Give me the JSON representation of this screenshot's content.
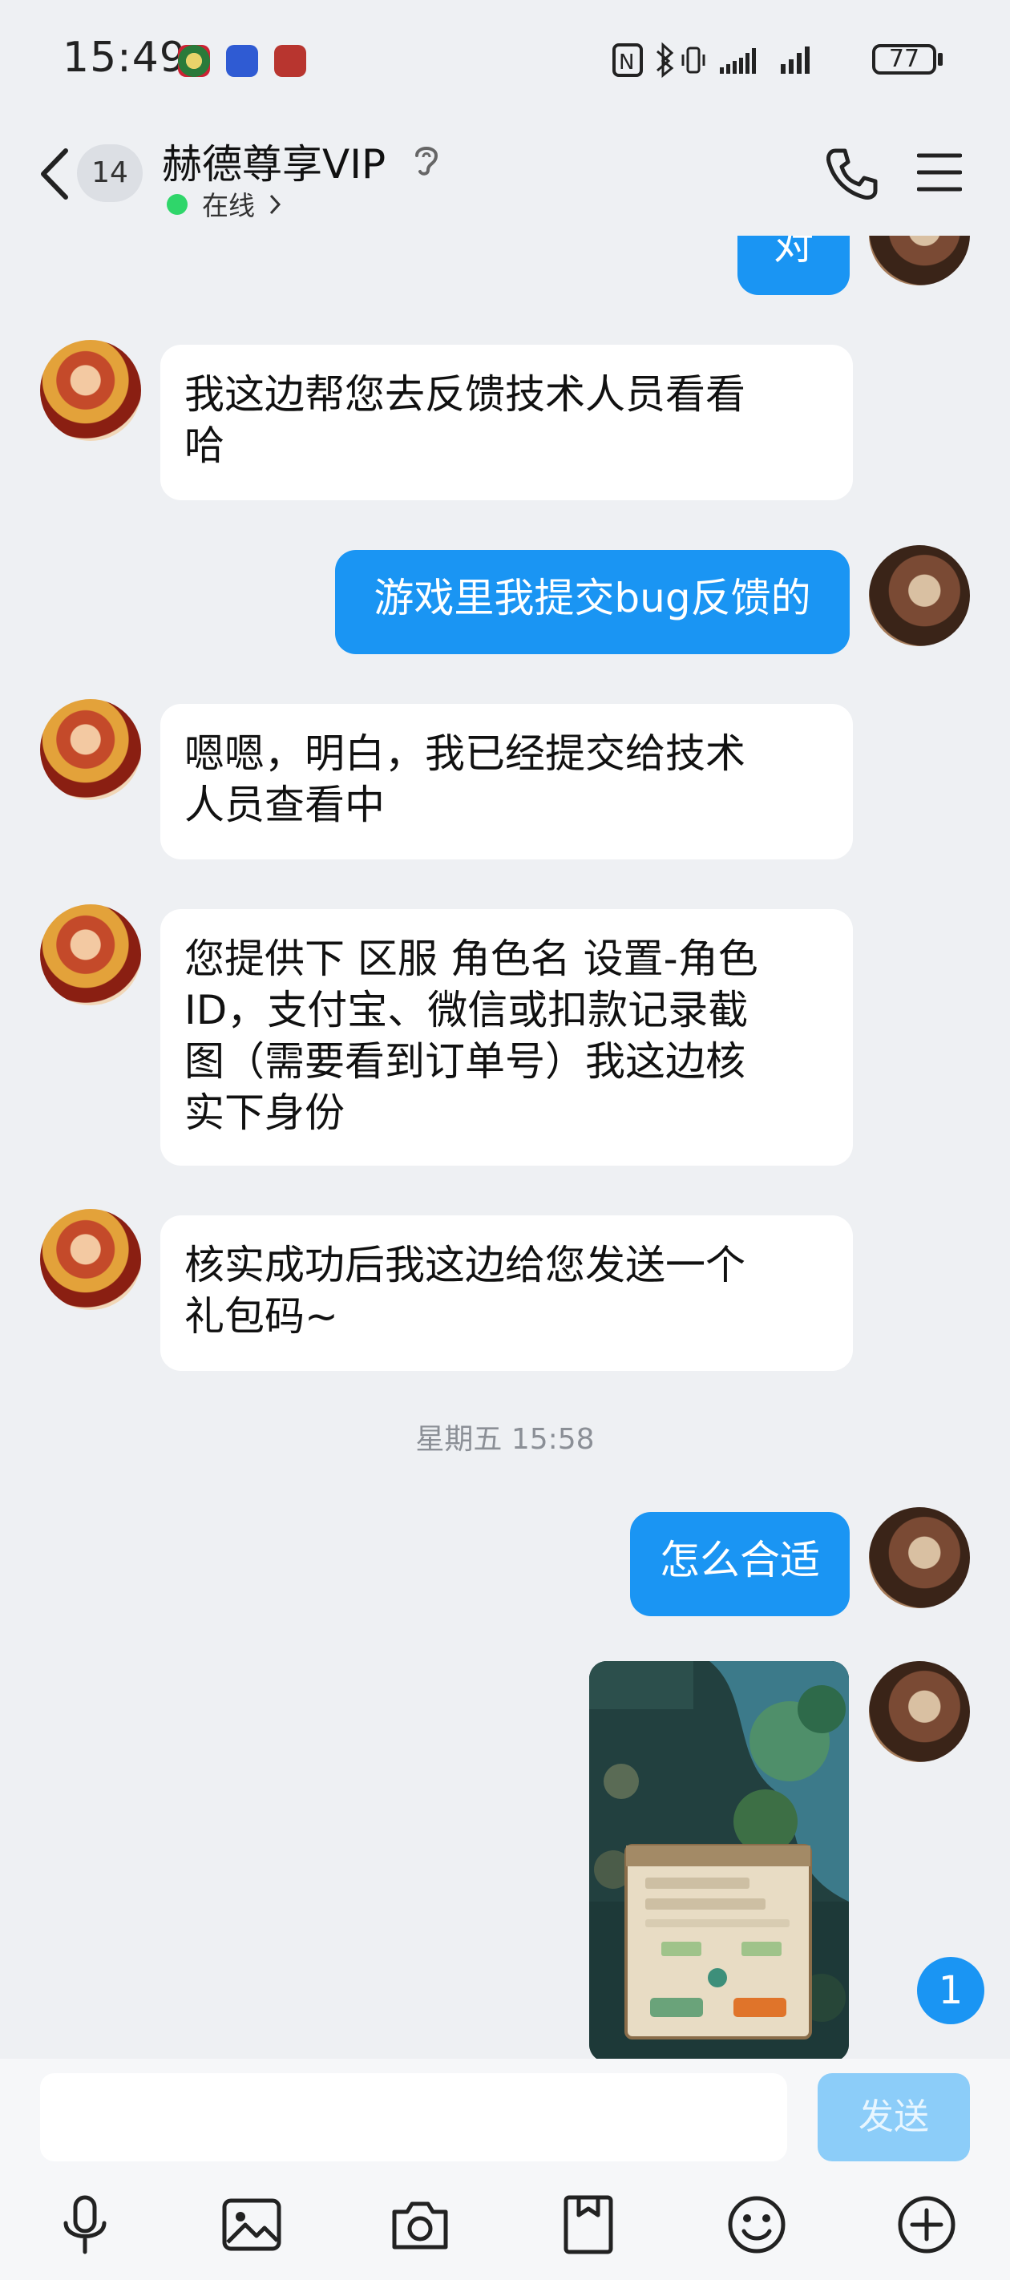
{
  "status_bar": {
    "time": "15:49",
    "battery": "77"
  },
  "header": {
    "unread_count": "14",
    "title": "赫德尊享VIP",
    "status": "在线"
  },
  "messages": [
    {
      "side": "right",
      "text": "对"
    },
    {
      "side": "left",
      "lines": [
        "我这边帮您去反馈技术人员看看",
        "哈"
      ]
    },
    {
      "side": "right",
      "text": "游戏里我提交bug反馈的"
    },
    {
      "side": "left",
      "lines": [
        "嗯嗯，明白，我已经提交给技术",
        "人员查看中"
      ]
    },
    {
      "side": "left",
      "lines": [
        "您提供下 区服 角色名 设置-角色",
        "ID，支付宝、微信或扣款记录截",
        "图（需要看到订单号）我这边核",
        "实下身份"
      ]
    },
    {
      "side": "left",
      "lines": [
        "核实成功后我这边给您发送一个",
        "礼包码~"
      ]
    },
    {
      "side": "right",
      "text": "怎么合适"
    }
  ],
  "timestamp": "星期五 15:58",
  "unread_float": "1",
  "input": {
    "placeholder": "",
    "send_label": "发送"
  },
  "toolbar": [
    "mic-icon",
    "image-icon",
    "camera-icon",
    "file-icon",
    "emoji-icon",
    "plus-icon"
  ],
  "colors": {
    "accent": "#1a95f3",
    "bg": "#eef0f3"
  }
}
